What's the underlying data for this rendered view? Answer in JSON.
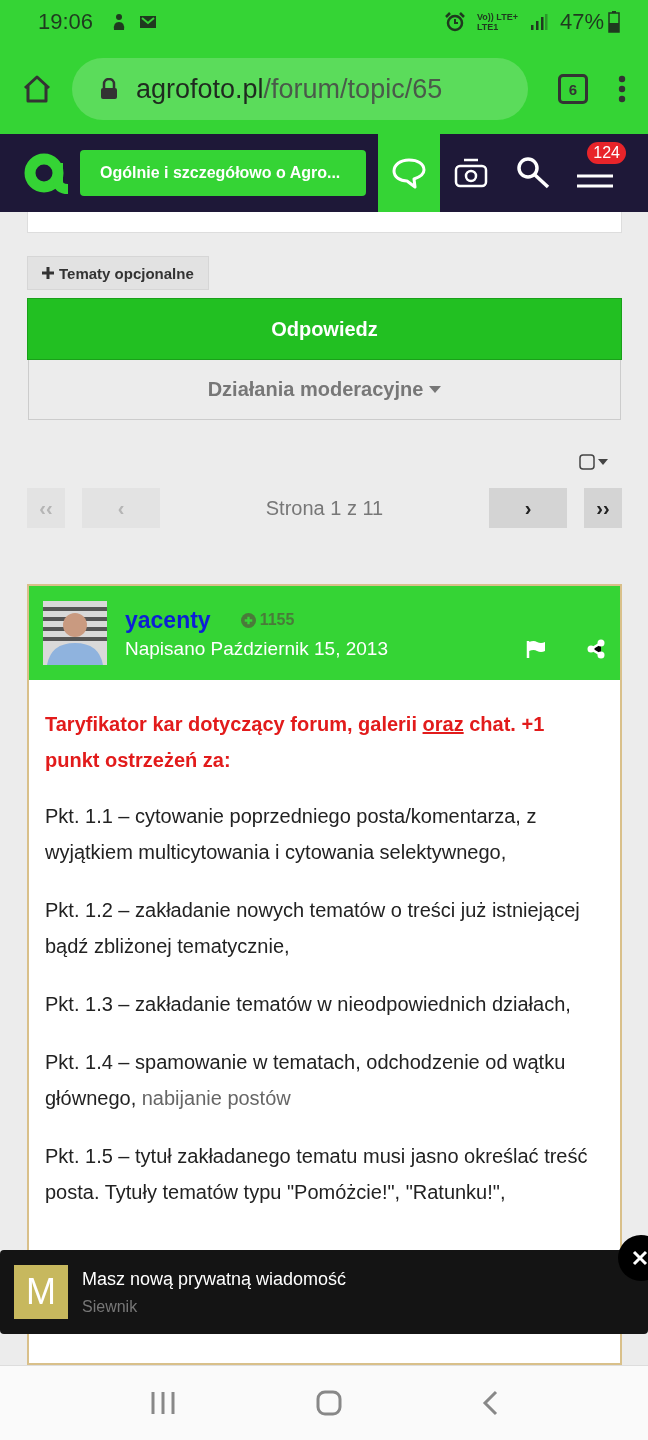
{
  "status_bar": {
    "time": "19:06",
    "network_top": "Vo)) LTE+",
    "network_bottom": "LTE1",
    "battery": "47%"
  },
  "browser": {
    "url_host": "agrofoto.pl",
    "url_path": "/forum/topic/65",
    "tab_count": "6"
  },
  "site_nav": {
    "breadcrumb": "Ogólnie i szczegółowo o Agro...",
    "items": [
      {
        "kind": "chat",
        "selected": true
      },
      {
        "kind": "camera",
        "selected": false
      },
      {
        "kind": "search",
        "selected": false
      },
      {
        "kind": "menu",
        "selected": false,
        "badge": "124"
      }
    ]
  },
  "optional_topics_button": "Tematy opcjonalne",
  "reply_button": "Odpowiedz",
  "moderation_button": "Działania moderacyjne",
  "select_checkbox": {
    "checked": false
  },
  "pagination": {
    "label": "Strona 1 z 11",
    "buttons": [
      {
        "glyph": "‹‹",
        "kind": "first",
        "disabled": true
      },
      {
        "glyph": "‹",
        "kind": "prev",
        "disabled": true
      },
      {
        "glyph": "›",
        "kind": "next",
        "disabled": false
      },
      {
        "glyph": "››",
        "kind": "last",
        "disabled": false
      }
    ]
  },
  "post": {
    "author": "yacenty",
    "reputation": "1155",
    "date": "Napisano Październik 15, 2013",
    "heading": [
      {
        "text": "Taryfikator kar dotyczący forum, galerii "
      },
      {
        "text": "oraz",
        "kind": "link"
      },
      {
        "text": " chat. +1 punkt ostrzeżeń za:"
      }
    ],
    "paragraphs": [
      [
        {
          "text": "Pkt. 1.1 – cytowanie poprzedniego posta/komentarza, z wyjątkiem multicytowania i cytowania selektywnego,"
        }
      ],
      [
        {
          "text": "Pkt. 1.2 – zakładanie nowych tematów o treści już istniejącej bądź zbliżonej tematycznie,"
        }
      ],
      [
        {
          "text": "Pkt. 1.3 – zakładanie tematów w nieodpowiednich działach,"
        }
      ],
      [
        {
          "text": "Pkt. 1.4 – spamowanie w tematach, odchodzenie od wątku głównego, "
        },
        {
          "text": "nabijanie postów",
          "kind": "muted"
        }
      ],
      [
        {
          "text": "Pkt. 1.5 – tytuł zakładanego tematu musi jasno określać treść posta. Tytuły tematów typu \"Pomóżcie!\", \"Ratunku!\","
        }
      ]
    ]
  },
  "toast": {
    "initial": "M",
    "title": "Masz nową prywatną wiadomość",
    "subtitle": "Siewnik"
  }
}
